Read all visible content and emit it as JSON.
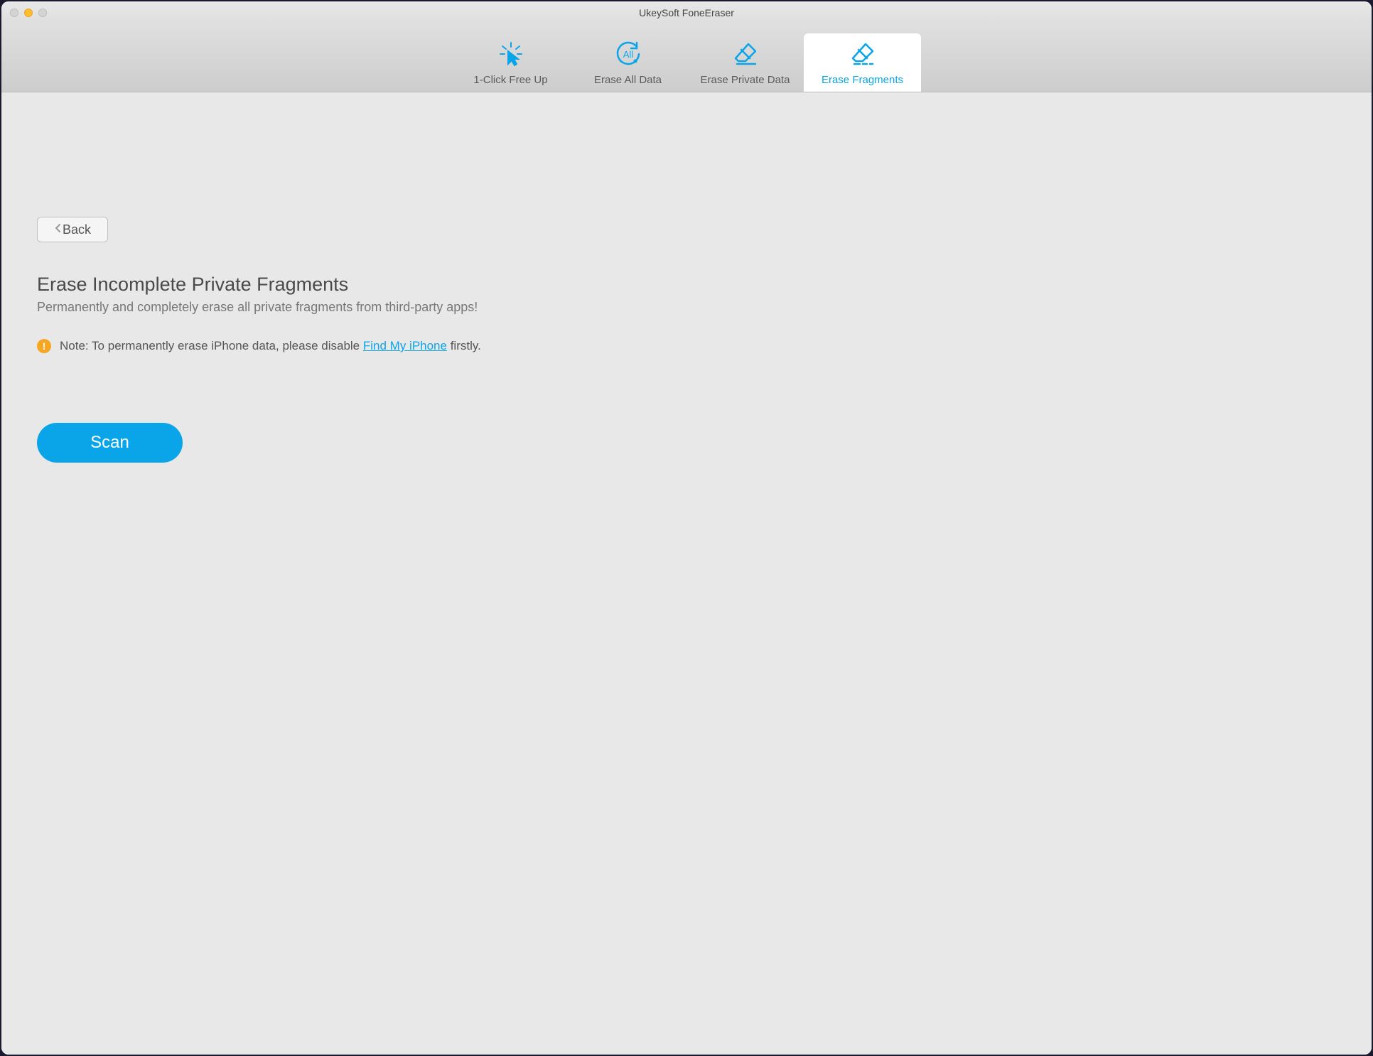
{
  "window": {
    "title": "UkeySoft FoneEraser"
  },
  "tabs": [
    {
      "label": "1-Click Free Up",
      "active": false
    },
    {
      "label": "Erase All Data",
      "active": false
    },
    {
      "label": "Erase Private Data",
      "active": false
    },
    {
      "label": "Erase Fragments",
      "active": true
    }
  ],
  "back": {
    "label": "Back"
  },
  "page": {
    "title": "Erase Incomplete Private Fragments",
    "subtitle": "Permanently and completely erase all private fragments from third-party apps!"
  },
  "note": {
    "label": "Note:",
    "text_before": " To permanently erase iPhone data, please disable ",
    "link_text": "Find My iPhone",
    "text_after": " firstly."
  },
  "scan": {
    "label": "Scan"
  },
  "colors": {
    "accent": "#0aa5e8",
    "warning": "#f5a623"
  }
}
